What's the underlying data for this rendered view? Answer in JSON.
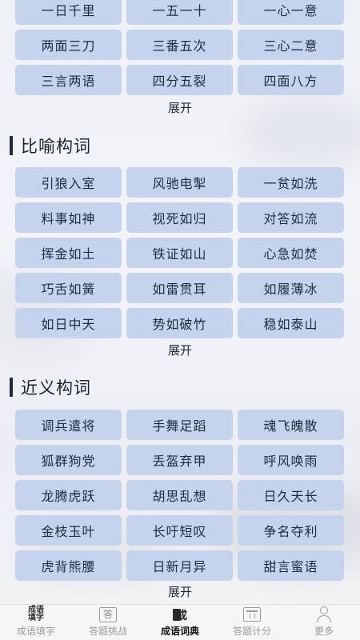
{
  "sections": [
    {
      "title": "",
      "items": [
        "一日千里",
        "一五一十",
        "一心一意",
        "两面三刀",
        "三番五次",
        "三心二意",
        "三言两语",
        "四分五裂",
        "四面八方"
      ],
      "expand_label": "展开"
    },
    {
      "title": "比喻构词",
      "items": [
        "引狼入室",
        "风驰电掣",
        "一贫如洗",
        "料事如神",
        "视死如归",
        "对答如流",
        "挥金如土",
        "铁证如山",
        "心急如焚",
        "巧舌如簧",
        "如雷贯耳",
        "如履薄冰",
        "如日中天",
        "势如破竹",
        "稳如泰山"
      ],
      "expand_label": "展开"
    },
    {
      "title": "近义构词",
      "items": [
        "调兵遣将",
        "手舞足蹈",
        "魂飞魄散",
        "狐群狗党",
        "丢盔弃甲",
        "呼风唤雨",
        "龙腾虎跃",
        "胡思乱想",
        "日久天长",
        "金枝玉叶",
        "长吁短叹",
        "争名夺利",
        "虎背熊腰",
        "日新月异",
        "甜言蜜语"
      ],
      "expand_label": "展开"
    }
  ],
  "tabbar": [
    {
      "label": "成语填字",
      "icon": "idiom-fill-icon",
      "icon_text": "成语填字",
      "active": false
    },
    {
      "label": "答题挑战",
      "icon": "answer-challenge-icon",
      "icon_text": "答",
      "active": false
    },
    {
      "label": "成语词典",
      "icon": "dictionary-icon",
      "icon_text": "成",
      "active": true
    },
    {
      "label": "答题计分",
      "icon": "score-icon",
      "icon_text": "",
      "active": false
    },
    {
      "label": "更多",
      "icon": "user-icon",
      "icon_text": "",
      "active": false
    }
  ]
}
